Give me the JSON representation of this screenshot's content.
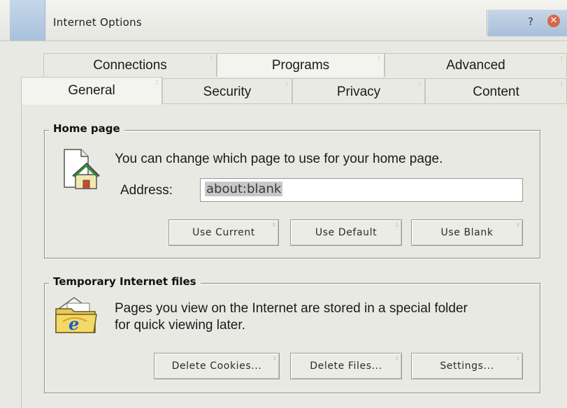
{
  "window": {
    "title": "Internet Options",
    "help_label": "?",
    "close_label": "✕"
  },
  "tabs": {
    "row1": [
      {
        "label": "Connections"
      },
      {
        "label": "Programs"
      },
      {
        "label": "Advanced"
      }
    ],
    "row2": [
      {
        "label": "General"
      },
      {
        "label": "Security"
      },
      {
        "label": "Privacy"
      },
      {
        "label": "Content"
      }
    ],
    "active": "General",
    "grip": "::"
  },
  "home_page": {
    "legend": "Home page",
    "description": "You can change which page to use for your home page.",
    "address_label": "Address:",
    "address_value": "about:blank",
    "buttons": {
      "use_current": "Use Current",
      "use_default": "Use Default",
      "use_blank": "Use Blank"
    },
    "icon": "home-page-icon"
  },
  "temp_files": {
    "legend": "Temporary Internet files",
    "description_line1": "Pages you view on the Internet are stored in a special folder",
    "description_line2": "for quick viewing later.",
    "buttons": {
      "delete_cookies": "Delete Cookies...",
      "delete_files": "Delete Files...",
      "settings": "Settings..."
    },
    "icon": "ie-folder-icon"
  },
  "colors": {
    "background": "#e9e9e4",
    "title_accent": "#b7cbe2",
    "close": "#d7684a"
  }
}
